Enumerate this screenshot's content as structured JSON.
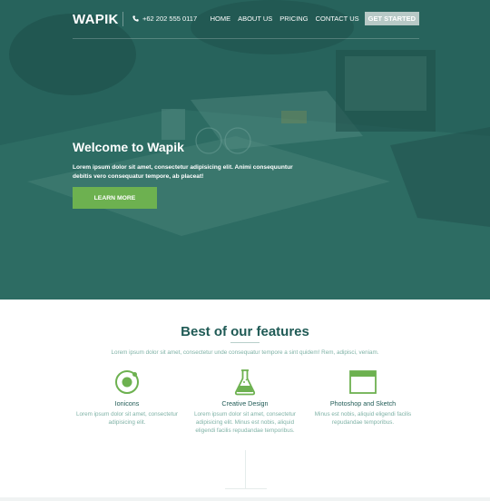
{
  "nav": {
    "logo": "WAPIK",
    "phone": "+62 202 555 0117",
    "items": [
      {
        "label": "HOME"
      },
      {
        "label": "ABOUT US"
      },
      {
        "label": "PRICING"
      },
      {
        "label": "CONTACT US"
      }
    ],
    "cta": "GET STARTED"
  },
  "hero": {
    "title": "Welcome to Wapik",
    "subtitle": "Lorem ipsum dolor sit amet, consectetur adipisicing elit. Animi consequuntur debitis vero consequatur tempore, ab placeat!",
    "button": "LEARN MORE"
  },
  "features": {
    "title": "Best of our features",
    "subtitle": "Lorem ipsum dolor sit amet, consectetur unde consequatur tempore a sint quidem! Rem, adipisci, veniam.",
    "items": [
      {
        "icon": "ionic-icon",
        "title": "Ionicons",
        "desc": "Lorem ipsum dolor sit amet, consectetur adipisicing elit."
      },
      {
        "icon": "flask-icon",
        "title": "Creative Design",
        "desc": "Lorem ipsum dolor sit amet, consectetur adipisicing elit. Minus est nobis, aliquid eligendi facilis repudandae temporibus."
      },
      {
        "icon": "window-icon",
        "title": "Photoshop and Sketch",
        "desc": "Minus est nobis, aliquid eligendi facilis repudandae temporibus."
      }
    ]
  },
  "colors": {
    "hero_bg": "#2c6d63",
    "accent_green": "#6db150",
    "heading_teal": "#1f5a55",
    "muted_teal": "#7fb2a6"
  }
}
